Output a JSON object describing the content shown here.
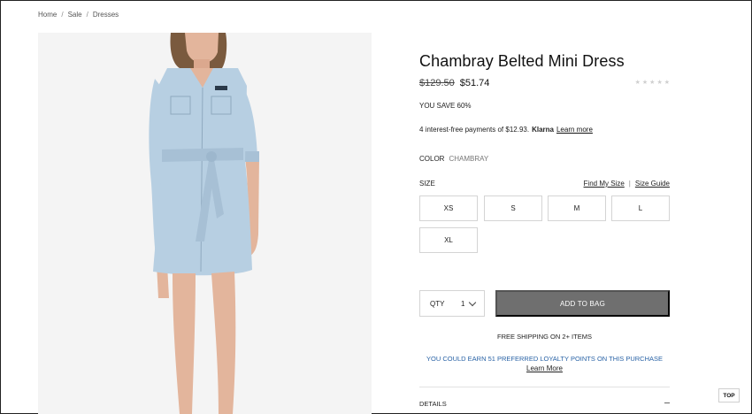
{
  "breadcrumb": [
    "Home",
    "Sale",
    "Dresses"
  ],
  "breadcrumb_separator": "/",
  "product": {
    "title": "Chambray Belted Mini Dress",
    "price_original": "$129.50",
    "price_sale": "$51.74",
    "rating_stars": 5,
    "rating_filled": 0,
    "save_text": "YOU SAVE 60%",
    "klarna_text": "4 interest-free payments of $12.93.",
    "klarna_brand": "Klarna",
    "klarna_learn": "Learn more",
    "color_label": "COLOR",
    "color_value": "CHAMBRAY"
  },
  "size": {
    "label": "SIZE",
    "find_my_size": "Find My Size",
    "link_separator": "|",
    "size_guide": "Size Guide",
    "options": [
      "XS",
      "S",
      "M",
      "L",
      "XL"
    ]
  },
  "purchase": {
    "qty_label": "QTY",
    "qty_value": "1",
    "add_to_bag": "ADD TO BAG",
    "shipping": "FREE SHIPPING ON 2+ ITEMS",
    "loyalty": "YOU COULD EARN 51 PREFERRED LOYALTY POINTS ON THIS PURCHASE",
    "loyalty_learn": "Learn More"
  },
  "details_label": "DETAILS",
  "top_button": "TOP",
  "colors": {
    "dress": "#b7cfe2",
    "add_to_bag_bg": "#6f6f6f",
    "loyalty_text": "#2a63a6",
    "gallery_bg": "#f4f4f4"
  }
}
